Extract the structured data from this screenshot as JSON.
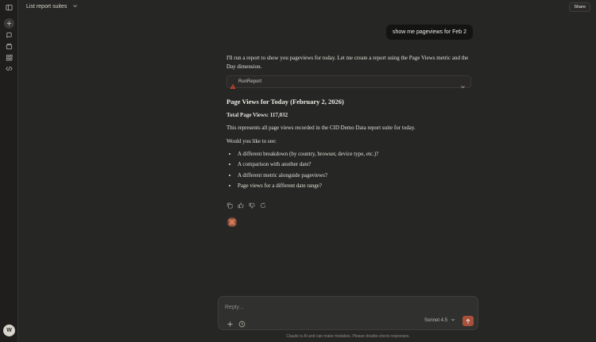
{
  "header": {
    "title": "List report suites",
    "share_label": "Share"
  },
  "rail": {
    "icons": [
      "sidebar-toggle-icon",
      "new-chat-icon",
      "search-chats-icon",
      "projects-icon",
      "artifacts-icon",
      "code-icon"
    ],
    "avatar_letter": "W"
  },
  "conversation": {
    "user_message": "show me pageviews for Feb 2",
    "assistant": {
      "intro": "I'll run a report to show you pageviews for today. Let me create a report using the Page Views metric and the Day dimension.",
      "tool_name": "RunReport",
      "heading": "Page Views for Today (February 2, 2026)",
      "total": "Total Page Views: 117,032",
      "description": "This represents all page views recorded in the CID Demo Data report suite for today.",
      "prompt": "Would you like to see:",
      "options": [
        "A different breakdown (by country, browser, device type, etc.)?",
        "A comparison with another date?",
        "A different metric alongside pageviews?",
        "Page views for a different date range?"
      ]
    }
  },
  "composer": {
    "placeholder": "Reply...",
    "value": "",
    "model": "Sonnet 4.5",
    "disclaimer": "Claude is AI and can make mistakes. Please double-check responses."
  },
  "colors": {
    "background": "#262624",
    "accent": "#a8513a",
    "spark": "#d97757"
  }
}
